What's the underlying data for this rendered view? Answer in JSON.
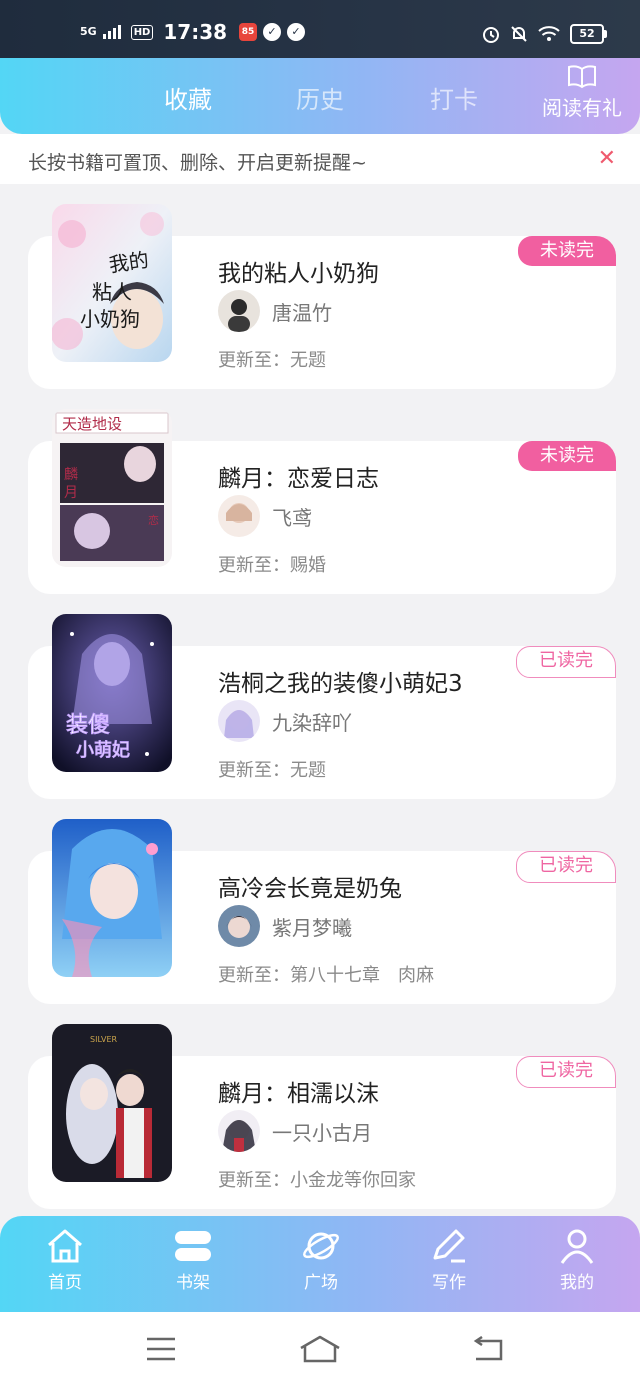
{
  "status_bar": {
    "signal": "5G",
    "hd": "HD",
    "time": "17:38",
    "app_badge": "85",
    "battery": "52"
  },
  "header": {
    "tabs": [
      {
        "label": "收藏",
        "active": true
      },
      {
        "label": "历史",
        "active": false
      },
      {
        "label": "打卡",
        "active": false
      }
    ],
    "reward_label": "阅读有礼"
  },
  "notice": {
    "text": "长按书籍可置顶、删除、开启更新提醒~",
    "close": "✕"
  },
  "books": [
    {
      "title": "我的粘人小奶狗",
      "author": "唐温竹",
      "update": "更新至：无题",
      "status": "未读完",
      "status_type": "unread",
      "cover_colors": [
        "#f7d4e6",
        "#b8d6ef"
      ],
      "cover_text": "我的粘人小奶狗"
    },
    {
      "title": "麟月：恋爱日志",
      "author": "飞鸢",
      "update": "更新至：赐婚",
      "status": "未读完",
      "status_type": "unread",
      "cover_colors": [
        "#f4f0f2",
        "#3a3040"
      ],
      "cover_text": "天造地设"
    },
    {
      "title": "浩桐之我的装傻小萌妃3",
      "author": "九染辞吖",
      "update": "更新至：无题",
      "status": "已读完",
      "status_type": "read",
      "cover_colors": [
        "#1a1a35",
        "#b7a6ea"
      ],
      "cover_text": "装傻小萌妃"
    },
    {
      "title": "高冷会长竟是奶兔",
      "author": "紫月梦曦",
      "update": "更新至：第八十七章　肉麻",
      "status": "已读完",
      "status_type": "read",
      "cover_colors": [
        "#1f6fd4",
        "#9fd4f5"
      ],
      "cover_text": ""
    },
    {
      "title": "麟月：相濡以沫",
      "author": "一只小古月",
      "update": "更新至：小金龙等你回家",
      "status": "已读完",
      "status_type": "read",
      "cover_colors": [
        "#1d1d2a",
        "#d5d8ea"
      ],
      "cover_text": ""
    }
  ],
  "bottom_nav": [
    {
      "label": "首页",
      "icon": "home-icon"
    },
    {
      "label": "书架",
      "icon": "bookshelf-icon"
    },
    {
      "label": "广场",
      "icon": "planet-icon"
    },
    {
      "label": "写作",
      "icon": "pen-icon"
    },
    {
      "label": "我的",
      "icon": "user-icon"
    }
  ],
  "colors": {
    "header_gradient_start": "#53d6f5",
    "header_gradient_end": "#c5a6f0",
    "unread_badge": "#f15fa0",
    "read_badge_text": "#ef66a2",
    "close_x": "#ef5a6e"
  }
}
